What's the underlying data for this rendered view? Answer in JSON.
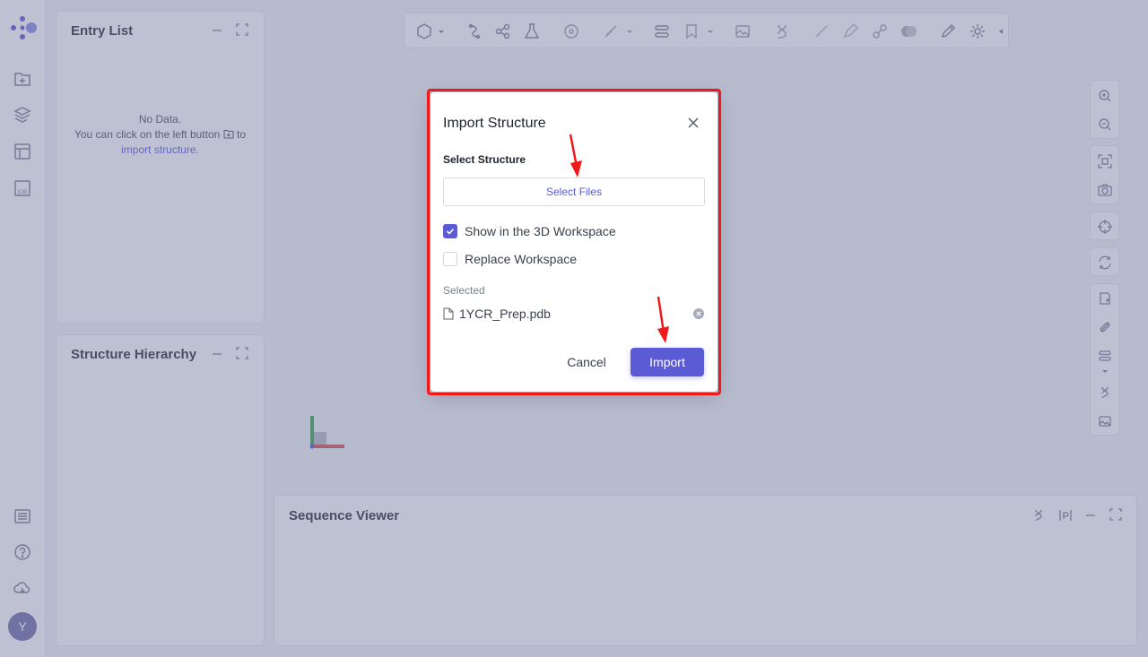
{
  "entry_list": {
    "title": "Entry List",
    "empty_line1": "No Data.",
    "empty_line2_before": "You can click on the left button",
    "empty_line2_after": "to",
    "empty_link": "import structure."
  },
  "structure_hierarchy": {
    "title": "Structure Hierarchy"
  },
  "sequence_viewer": {
    "title": "Sequence Viewer"
  },
  "user": {
    "initial": "Y"
  },
  "modal": {
    "title": "Import Structure",
    "section_label": "Select Structure",
    "select_files": "Select Files",
    "option_show": "Show in the 3D Workspace",
    "option_show_checked": true,
    "option_replace": "Replace Workspace",
    "option_replace_checked": false,
    "selected_label": "Selected",
    "file_name": "1YCR_Prep.pdb",
    "cancel_label": "Cancel",
    "import_label": "Import"
  },
  "colors": {
    "accent": "#5b5bd6",
    "highlight": "#f01818",
    "axis_x": "#d9534f",
    "axis_y": "#3aa655",
    "axis_z": "#4a5bd6"
  },
  "icons": {
    "rail": [
      "logo-icon",
      "new-project-icon",
      "layers-icon",
      "layout-icon",
      "job-icon",
      "list-icon",
      "help-icon",
      "cloud-icon"
    ],
    "toolbar": [
      "hexagon-icon",
      "rotate-icon",
      "molecule-icon",
      "flask-icon",
      "target-icon",
      "ruler-icon",
      "align-icon",
      "bookmark-icon",
      "image-icon",
      "dna-icon",
      "line-icon",
      "pencil-icon",
      "link-icon",
      "surface-icon",
      "edit-icon",
      "gear-icon"
    ],
    "right_tools": [
      "zoom-in-icon",
      "zoom-out-icon",
      "fit-icon",
      "camera-icon",
      "center-icon",
      "refresh-icon",
      "label-icon",
      "measure-icon",
      "align-icon",
      "sequence-icon",
      "image-icon"
    ]
  }
}
